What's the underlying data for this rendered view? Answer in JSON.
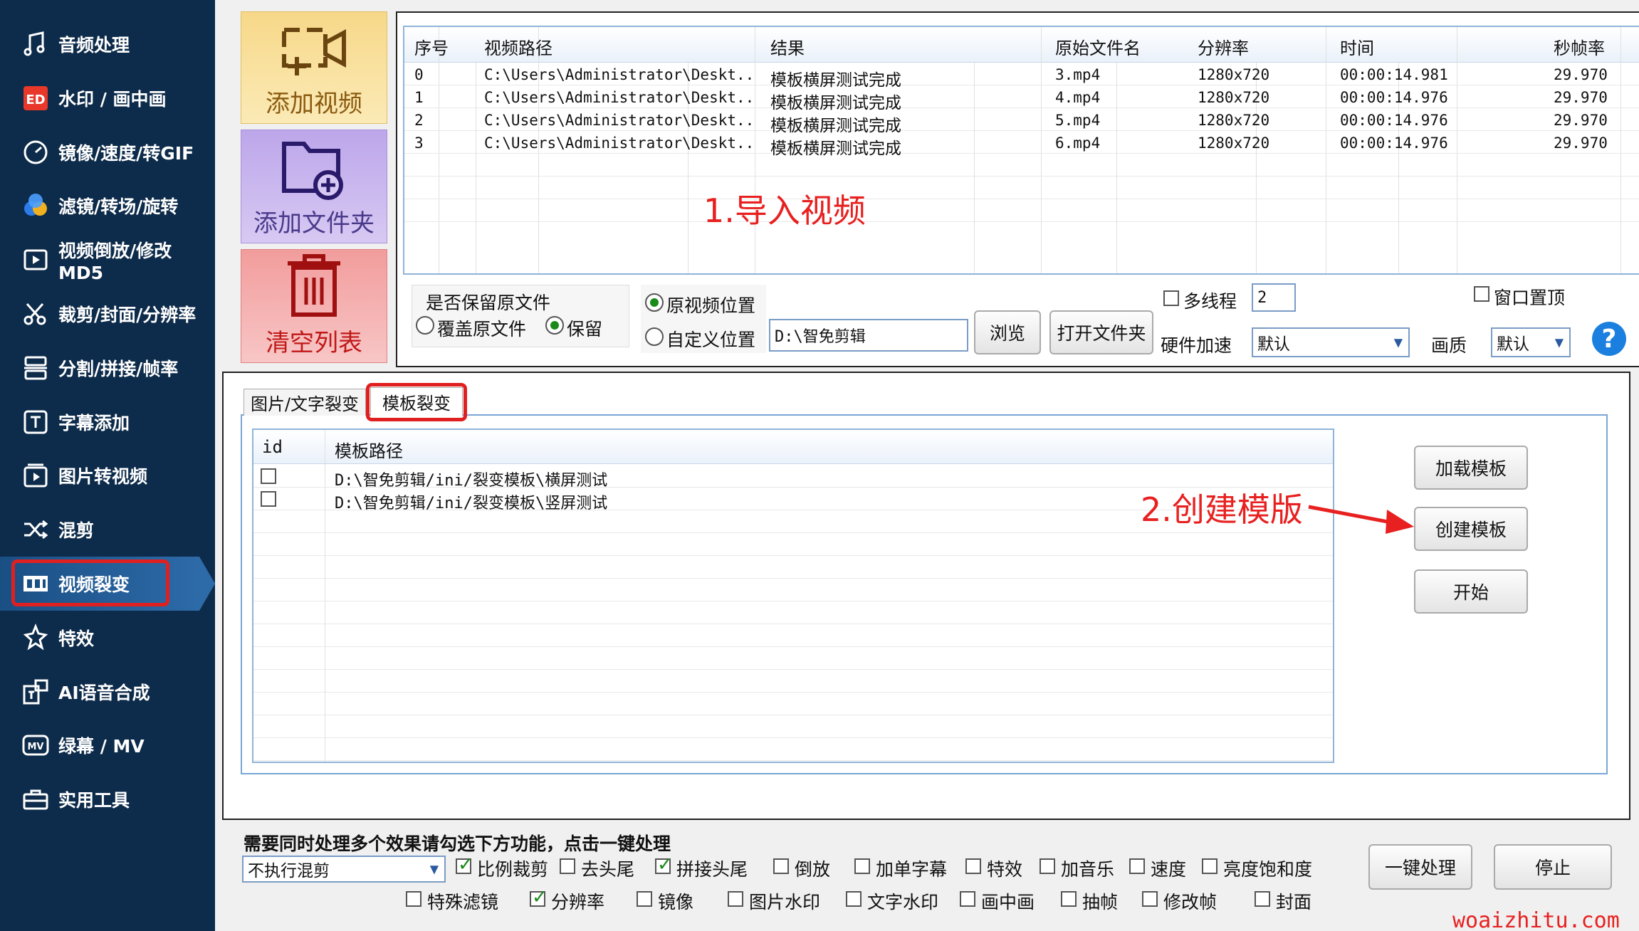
{
  "sidebar": {
    "items": [
      {
        "label": "音频处理",
        "icon": "music-note-icon"
      },
      {
        "label": "水印 / 画中画",
        "icon": "watermark-icon"
      },
      {
        "label": "镜像/速度/转GIF",
        "icon": "speedometer-icon"
      },
      {
        "label": "滤镜/转场/旋转",
        "icon": "color-circles-icon"
      },
      {
        "label": "视频倒放/修改MD5",
        "icon": "reverse-play-icon"
      },
      {
        "label": "裁剪/封面/分辨率",
        "icon": "scissors-icon"
      },
      {
        "label": "分割/拼接/帧率",
        "icon": "split-icon"
      },
      {
        "label": "字幕添加",
        "icon": "text-t-icon"
      },
      {
        "label": "图片转视频",
        "icon": "image-to-video-icon"
      },
      {
        "label": "混剪",
        "icon": "shuffle-icon"
      },
      {
        "label": "视频裂变",
        "icon": "film-split-icon"
      },
      {
        "label": "特效",
        "icon": "sparkle-icon"
      },
      {
        "label": "AI语音合成",
        "icon": "ai-voice-icon"
      },
      {
        "label": "绿幕 / MV",
        "icon": "mv-icon"
      },
      {
        "label": "实用工具",
        "icon": "toolbox-icon"
      }
    ]
  },
  "toolbar": {
    "add_video": "添加视频",
    "add_folder": "添加文件夹",
    "clear_list": "清空列表"
  },
  "video_table": {
    "headers": [
      "序号",
      "视频路径",
      "结果",
      "原始文件名",
      "分辨率",
      "时间",
      "秒帧率"
    ],
    "rows": [
      [
        "0",
        "C:\\Users\\Administrator\\Deskt...",
        "模板横屏测试完成",
        "3.mp4",
        "1280x720",
        "00:00:14.981",
        "29.970"
      ],
      [
        "1",
        "C:\\Users\\Administrator\\Deskt...",
        "模板横屏测试完成",
        "4.mp4",
        "1280x720",
        "00:00:14.976",
        "29.970"
      ],
      [
        "2",
        "C:\\Users\\Administrator\\Deskt...",
        "模板横屏测试完成",
        "5.mp4",
        "1280x720",
        "00:00:14.976",
        "29.970"
      ],
      [
        "3",
        "C:\\Users\\Administrator\\Deskt...",
        "模板横屏测试完成",
        "6.mp4",
        "1280x720",
        "00:00:14.976",
        "29.970"
      ]
    ]
  },
  "annotations": {
    "step1": "1.导入视频",
    "step2": "2.创建模版"
  },
  "options": {
    "keep_original_title": "是否保留原文件",
    "overwrite": "覆盖原文件",
    "keep": "保留",
    "original_location": "原视频位置",
    "custom_location": "自定义位置",
    "output_path": "D:\\智免剪辑",
    "browse": "浏览",
    "open_folder": "打开文件夹",
    "multithread": "多线程",
    "thread_count": "2",
    "window_top": "窗口置顶",
    "hw_accel_label": "硬件加速",
    "hw_accel_value": "默认",
    "quality_label": "画质",
    "quality_value": "默认",
    "help": "?"
  },
  "tabs": [
    "图片/文字裂变",
    "模板裂变"
  ],
  "template_table": {
    "headers": [
      "id",
      "模板路径"
    ],
    "rows": [
      "D:\\智免剪辑/ini/裂变模板\\横屏测试",
      "D:\\智免剪辑/ini/裂变模板\\竖屏测试"
    ]
  },
  "template_buttons": {
    "load": "加载模板",
    "create": "创建模板",
    "start": "开始"
  },
  "bottom": {
    "hint": "需要同时处理多个效果请勾选下方功能，点击一键处理",
    "mix_select": "不执行混剪",
    "checks": [
      {
        "label": "比例裁剪",
        "checked": true
      },
      {
        "label": "去头尾",
        "checked": false
      },
      {
        "label": "拼接头尾",
        "checked": true
      },
      {
        "label": "倒放",
        "checked": false
      },
      {
        "label": "加单字幕",
        "checked": false
      },
      {
        "label": "特效",
        "checked": false
      },
      {
        "label": "加音乐",
        "checked": false
      },
      {
        "label": "速度",
        "checked": false
      },
      {
        "label": "亮度饱和度",
        "checked": false
      },
      {
        "label": "特殊滤镜",
        "checked": false
      },
      {
        "label": "分辨率",
        "checked": true
      },
      {
        "label": "镜像",
        "checked": false
      },
      {
        "label": "图片水印",
        "checked": false
      },
      {
        "label": "文字水印",
        "checked": false
      },
      {
        "label": "画中画",
        "checked": false
      },
      {
        "label": "抽帧",
        "checked": false
      },
      {
        "label": "修改帧",
        "checked": false
      },
      {
        "label": "封面",
        "checked": false
      }
    ],
    "one_click": "一键处理",
    "stop": "停止"
  },
  "watermark": "woaizhitu.com",
  "colors": {
    "sidebar_bg": "#0d2b4a",
    "annotation_red": "#e82020",
    "add_video_bg": "#f9e29a",
    "add_folder_bg": "#c9b6ee",
    "clear_list_bg": "#f4b3b3"
  }
}
